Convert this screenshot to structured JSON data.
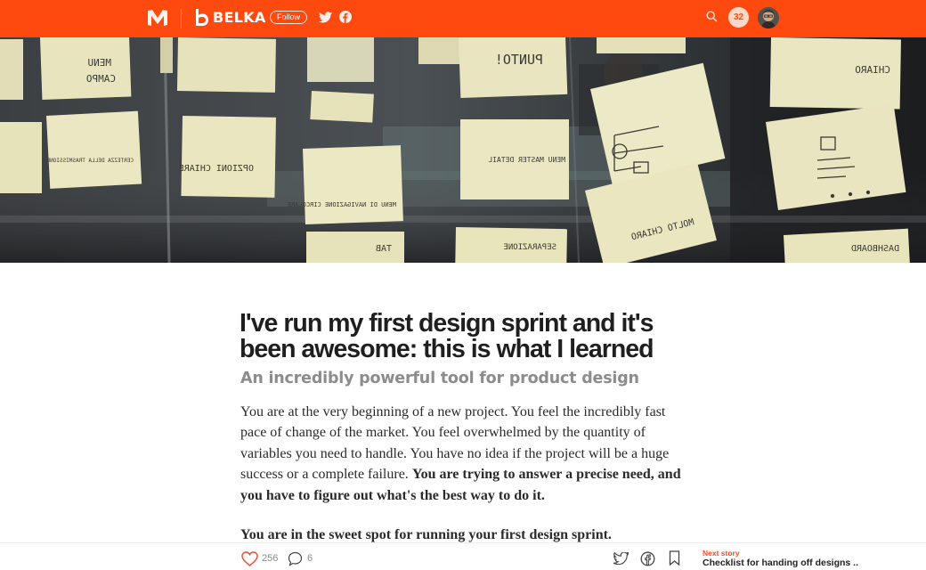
{
  "colors": {
    "brand": "#ff4a0f",
    "notif_bg": "#ffd8c9",
    "text": "#222222",
    "subtitle": "#8c8c8c",
    "clap": "#e0533a"
  },
  "header": {
    "site_logo_icon": "medium-m-icon",
    "publication_name": "BELKA",
    "follow_label": "Follow",
    "twitter_icon": "twitter-icon",
    "facebook_icon": "facebook-icon",
    "search_icon": "search-icon",
    "notification_count": "32",
    "avatar": "user-avatar"
  },
  "hero": {
    "notes": [
      "CHIARO",
      "MENU",
      "CAMPO",
      "PUNTO!",
      "OPZIONI CHIARE",
      "MENU DI NAVIGAZIONE CIRCOLARE",
      "MENU MASTER DETAIL",
      "MOLTO CHIARO",
      "CERTEZZA DELLA TRASMISSIONE",
      "SEPARAZIONE",
      "DASHBOARD",
      "TAB"
    ]
  },
  "article": {
    "title": "I've run my first design sprint and it's been awesome: this is what I learned",
    "subtitle": "An incredibly powerful tool for product design",
    "p1_normal": "You are at the very beginning of a new project. You feel the incredibly fast pace of change of the market. You feel overwhelmed by the quantity of variables you need to handle. You have no idea if the project will be a huge success or a complete failure. ",
    "p1_bold": "You are trying to answer a precise need, and you have to figure out what's the best way to do it.",
    "p2_bold": "You are in the sweet spot for running your first design sprint."
  },
  "footer": {
    "clap_icon": "heart-icon",
    "clap_count": "256",
    "response_icon": "comment-icon",
    "response_count": "6",
    "share_twitter_icon": "twitter-icon",
    "share_facebook_icon": "facebook-icon",
    "bookmark_icon": "bookmark-icon",
    "next_story_label": "Next story",
    "next_story_title": "Checklist for handing off designs ..."
  }
}
